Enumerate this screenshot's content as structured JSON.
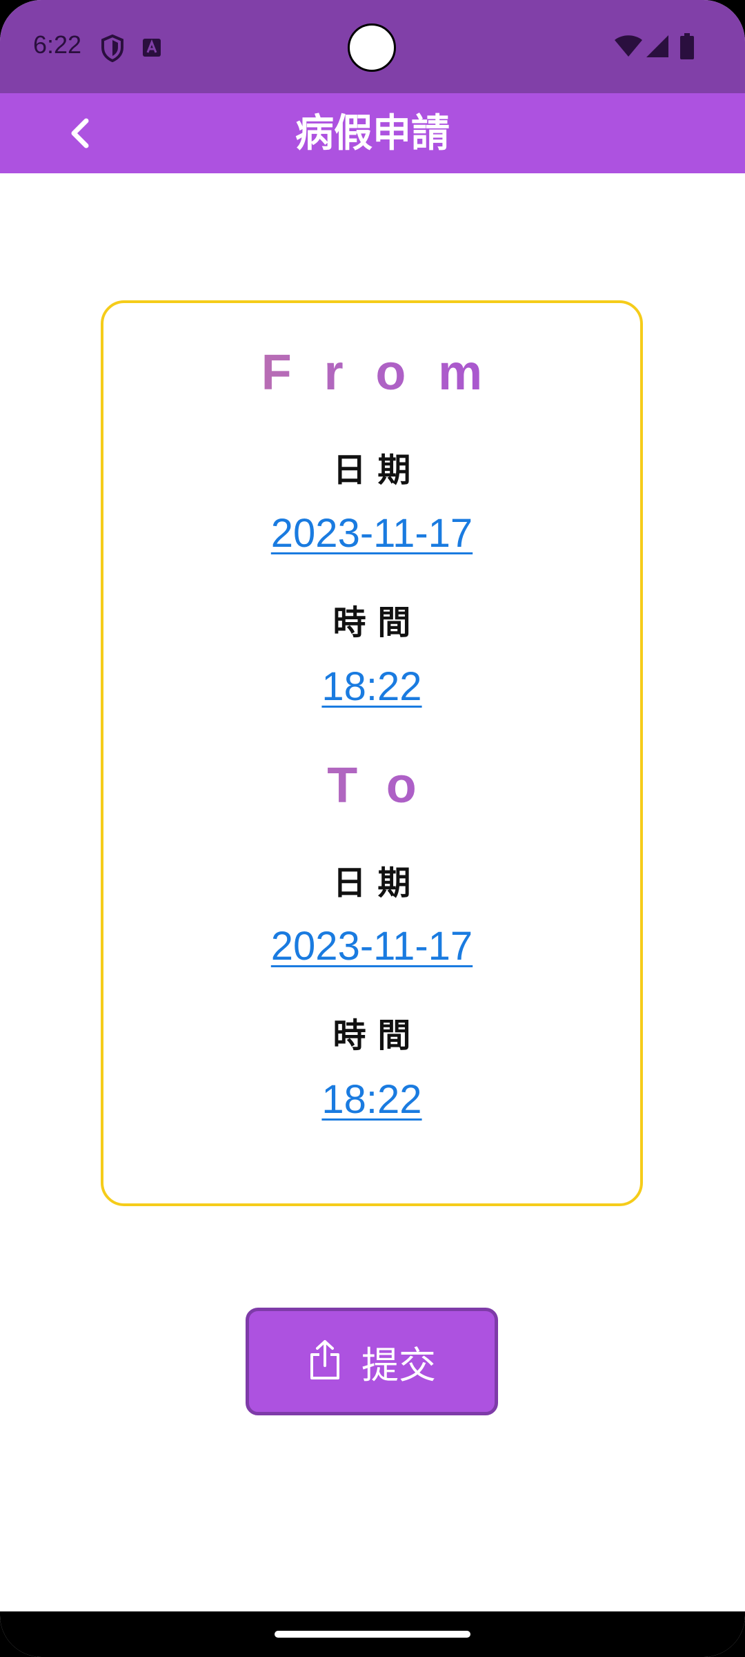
{
  "status_bar": {
    "time": "6:22",
    "icons_left": [
      "shield-icon",
      "a-box-icon"
    ],
    "icons_right": [
      "wifi-icon",
      "signal-icon",
      "battery-icon"
    ]
  },
  "app_bar": {
    "title": "病假申請",
    "back_icon": "chevron-left-icon",
    "background": "#ad52e0"
  },
  "form": {
    "from": {
      "heading": "From",
      "date_label": "日期",
      "date_value": "2023-11-17",
      "time_label": "時間",
      "time_value": "18:22"
    },
    "to": {
      "heading": "To",
      "date_label": "日期",
      "date_value": "2023-11-17",
      "time_label": "時間",
      "time_value": "18:22"
    },
    "card_border_color": "#f5cc1a",
    "link_color": "#1a7be0"
  },
  "submit": {
    "label": "提交",
    "icon": "share-upload-icon",
    "background": "#ad52e0"
  }
}
